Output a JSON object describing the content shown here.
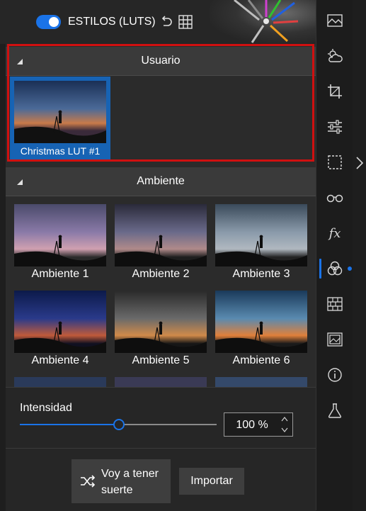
{
  "header": {
    "title": "ESTILOS (LUTS)",
    "toggle_on": true
  },
  "sections": {
    "usuario": {
      "title": "Usuario",
      "items": [
        {
          "label": "Christmas LUT #1"
        }
      ]
    },
    "ambiente": {
      "title": "Ambiente",
      "items": [
        {
          "label": "Ambiente 1"
        },
        {
          "label": "Ambiente 2"
        },
        {
          "label": "Ambiente 3"
        },
        {
          "label": "Ambiente 4"
        },
        {
          "label": "Ambiente 5"
        },
        {
          "label": "Ambiente 6"
        }
      ]
    }
  },
  "intensity": {
    "label": "Intensidad",
    "value_text": "100 %",
    "slider_fraction": 0.5
  },
  "buttons": {
    "luck_line1": "Voy a tener",
    "luck_line2": "suerte",
    "import": "Importar"
  },
  "toolbar": {
    "icons": [
      "landscape-presets-icon",
      "weather-sky-icon",
      "crop-icon",
      "adjust-sliders-icon",
      "selection-icon",
      "glasses-icon",
      "fx-icon",
      "luts-icon",
      "texture-brick-icon",
      "frame-icon",
      "info-icon",
      "lab-flask-icon"
    ],
    "fx_text": "fx",
    "active": "luts-icon"
  },
  "colors": {
    "accent": "#1a73e8",
    "highlight": "#d01010",
    "selected_tile": "#1763b4"
  }
}
